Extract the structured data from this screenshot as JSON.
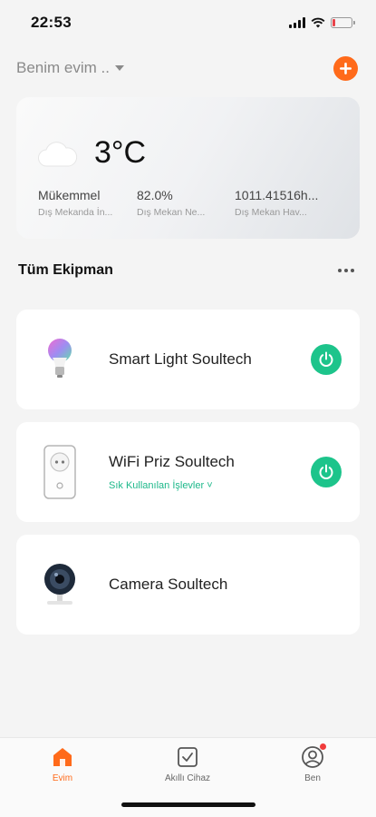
{
  "status_bar": {
    "time": "22:53"
  },
  "header": {
    "home_name": "Benim evim ..",
    "add_icon": "plus-icon"
  },
  "weather": {
    "temperature": "3°C",
    "icon": "cloud-icon",
    "stats": [
      {
        "value": "Mükemmel",
        "label": "Dış Mekanda İn..."
      },
      {
        "value": "82.0%",
        "label": "Dış Mekan Ne..."
      },
      {
        "value": "1011.41516h...",
        "label": "Dış Mekan Hav..."
      }
    ]
  },
  "section": {
    "title": "Tüm Ekipman"
  },
  "devices": [
    {
      "name": "Smart Light Soultech",
      "icon": "light-bulb-icon",
      "has_power": true
    },
    {
      "name": "WiFi Priz Soultech",
      "subtitle": "Sık Kullanılan İşlevler ˅",
      "icon": "smart-plug-icon",
      "has_power": true
    },
    {
      "name": "Camera Soultech",
      "icon": "camera-icon",
      "has_power": false
    }
  ],
  "tabs": [
    {
      "label": "Evim",
      "icon": "home-icon",
      "active": true
    },
    {
      "label": "Akıllı Cihaz",
      "icon": "checkbox-icon",
      "active": false
    },
    {
      "label": "Ben",
      "icon": "profile-icon",
      "active": false
    }
  ],
  "colors": {
    "accent": "#ff6a1a",
    "power_on": "#1dc48b",
    "badge": "#f03b3b"
  }
}
